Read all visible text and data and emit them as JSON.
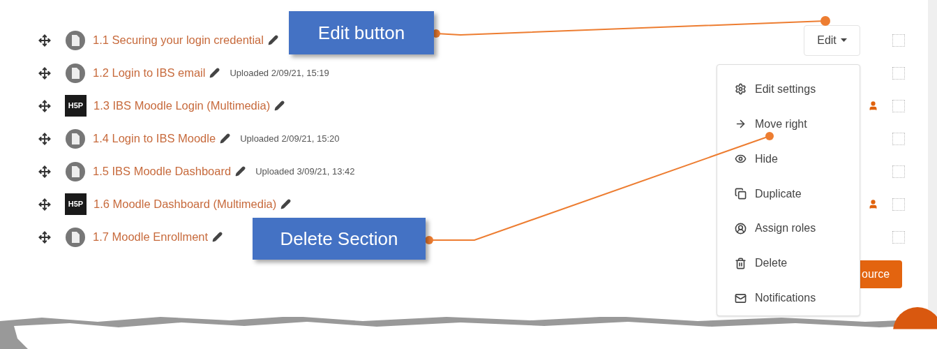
{
  "activities": [
    {
      "kind": "file",
      "title": "1.1 Securing your login credential",
      "group_icon": false,
      "checked": false
    },
    {
      "kind": "file",
      "title": "1.2 Login to IBS email",
      "uploaded": "Uploaded 2/09/21, 15:19",
      "group_icon": false,
      "checked": false
    },
    {
      "kind": "h5p",
      "logo": "H5P",
      "title": "1.3 IBS Moodle Login (Multimedia)",
      "group_icon": true,
      "checked": false
    },
    {
      "kind": "file",
      "title": "1.4 Login to IBS Moodle",
      "uploaded": "Uploaded 2/09/21, 15:20",
      "group_icon": false,
      "checked": false
    },
    {
      "kind": "file",
      "title": "1.5 IBS Moodle Dashboard",
      "uploaded": "Uploaded 3/09/21, 13:42",
      "group_icon": false,
      "checked": false
    },
    {
      "kind": "h5p",
      "logo": "H5P",
      "title": "1.6 Moodle Dashboard (Multimedia)",
      "group_icon": true,
      "checked": false
    },
    {
      "kind": "file",
      "title": "1.7 Moodle Enrollment",
      "group_icon": false,
      "checked": false
    }
  ],
  "edit_button": {
    "label": "Edit"
  },
  "edit_menu": [
    "Edit settings",
    "Move right",
    "Hide",
    "Duplicate",
    "Assign roles",
    "Delete",
    "Notifications"
  ],
  "add_button": {
    "label": "ource"
  },
  "callouts": [
    {
      "label": "Edit button"
    },
    {
      "label": "Delete Section"
    }
  ]
}
